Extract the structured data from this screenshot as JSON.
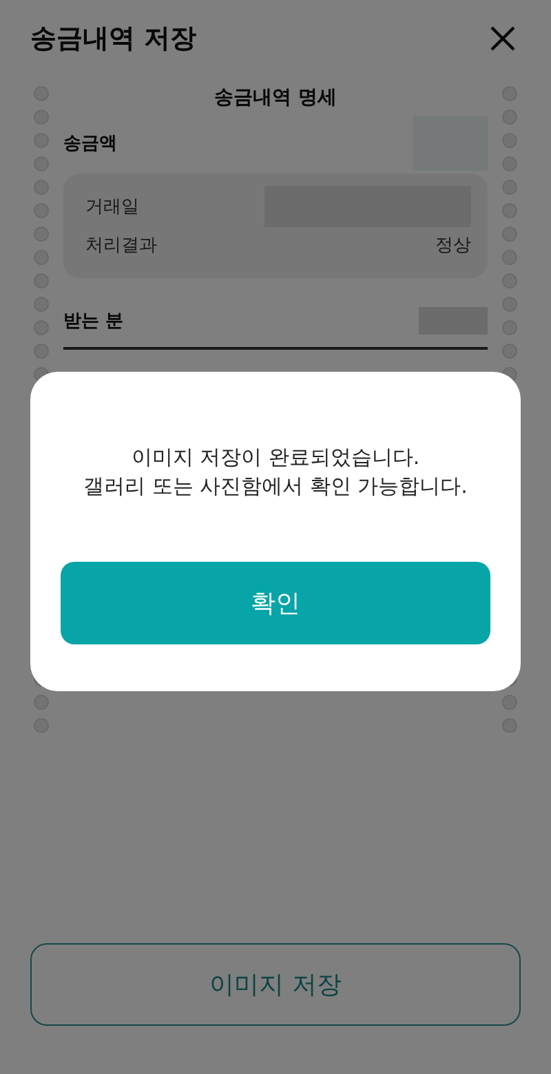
{
  "header": {
    "title": "송금내역 저장"
  },
  "receipt": {
    "title": "송금내역 명세",
    "amount_label": "송금액",
    "details": [
      {
        "label": "거래일",
        "value_redacted": true
      },
      {
        "label": "처리결과",
        "value": "정상"
      }
    ],
    "recipient_label": "받는 분"
  },
  "save_button": {
    "label": "이미지 저장"
  },
  "dialog": {
    "message_lines": [
      "이미지 저장이 완료되었습니다.",
      "갤러리 또는 사진함에서 확인 가능합니다."
    ],
    "confirm": "확인"
  }
}
